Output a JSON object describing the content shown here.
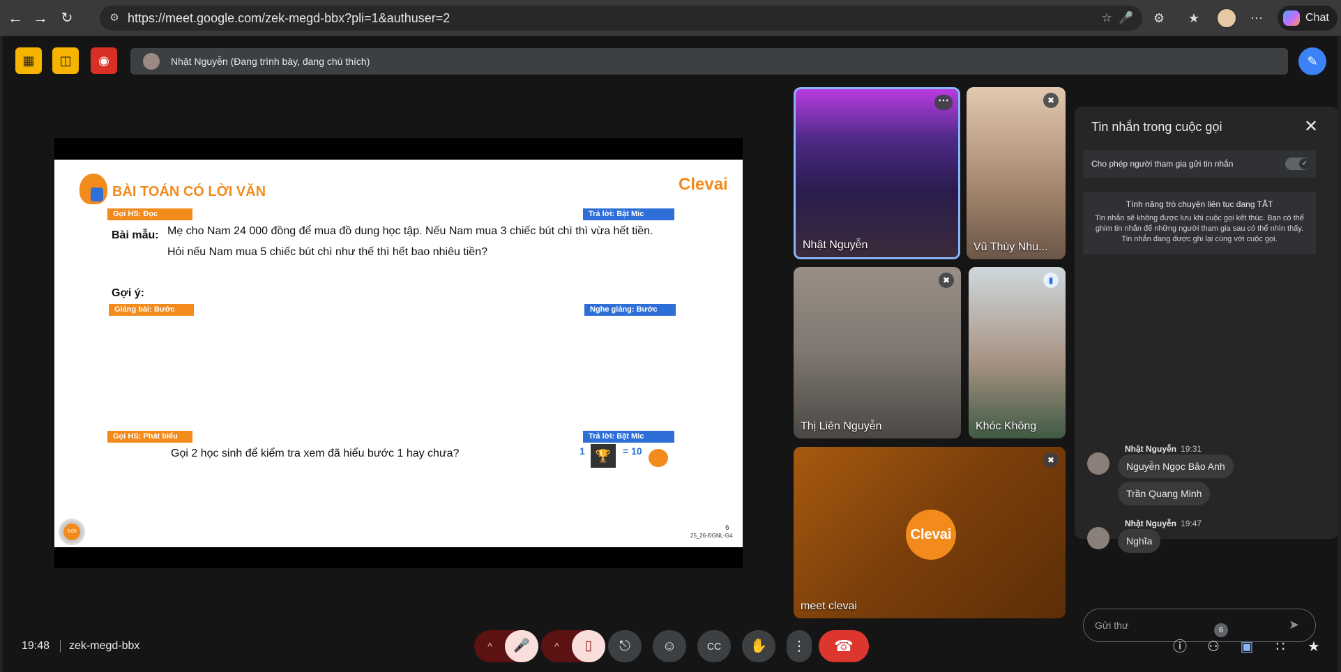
{
  "browser": {
    "url": "https://meet.google.com/zek-megd-bbx?pli=1&authuser=2",
    "chat_label": "Chat"
  },
  "presentation": {
    "banner": "Nhật Nguyễn (Đang trình bày, đang chú thích)"
  },
  "slide": {
    "title": "BÀI TOÁN CÓ LỜI VĂN",
    "brand": "Clevai",
    "tag_call_read": "Gọi HS: Đọc",
    "tag_answer_mic_1": "Trả lời: Bật Mic",
    "sample_label": "Bài mẫu:",
    "problem_line1": "Mẹ cho Nam 24 000 đồng để mua đồ dung học tập. Nếu Nam mua 3 chiếc bút chì thì vừa hết tiền.",
    "problem_line2": "Hỏi nếu Nam mua 5 chiếc bút chì như thế thì hết bao nhiêu tiền?",
    "hint_label": "Gợi ý:",
    "tag_teach": "Giảng bài: Bước giải",
    "tag_listen": "Nghe giảng: Bước giải",
    "tag_call_speak": "Gọi HS: Phát biểu",
    "tag_answer_mic_2": "Trả lời: Bật Mic",
    "question": "Gọi 2 học sinh để kiểm tra xem đã hiểu bước 1 hay chưa?",
    "reward_count": "1",
    "reward_equals": "= 10",
    "page_number": "6",
    "code": "25_26-ĐGNL-G4",
    "timer": "3:00"
  },
  "participants": [
    {
      "name": "Nhật Nguyễn"
    },
    {
      "name": "Vũ Thùy Nhu..."
    },
    {
      "name": "Thị Liên Nguyễn"
    },
    {
      "name": "Khóc Không"
    },
    {
      "name": "meet clevai",
      "badge": "Clevai"
    }
  ],
  "chat": {
    "header": "Tin nhắn trong cuộc gọi",
    "allow_label": "Cho phép người tham gia gửi tin nhắn",
    "info_title": "Tính năng trò chuyện liên tục đang TẮT",
    "info_body": "Tin nhắn sẽ không được lưu khi cuộc gọi kết thúc. Bạn có thể ghim tin nhắn để những người tham gia sau có thể nhìn thấy. Tin nhắn đang được ghi lại cùng với cuộc gọi.",
    "groups": [
      {
        "sender": "Nhật Nguyễn",
        "time": "19:31",
        "messages": [
          "Nguyễn Ngọc Bảo Anh",
          "Trần Quang Minh"
        ]
      },
      {
        "sender": "Nhật Nguyễn",
        "time": "19:47",
        "messages": [
          "Nghĩa"
        ]
      }
    ],
    "placeholder": "Gửi thư"
  },
  "footer": {
    "time": "19:48",
    "meeting_code": "zek-megd-bbx",
    "participant_count": "6"
  },
  "colors": {
    "brand_orange": "#f28a1c",
    "tag_blue": "#2d6fd6",
    "end_call_red": "#dc362e",
    "host_yellow": "#f6b400"
  }
}
